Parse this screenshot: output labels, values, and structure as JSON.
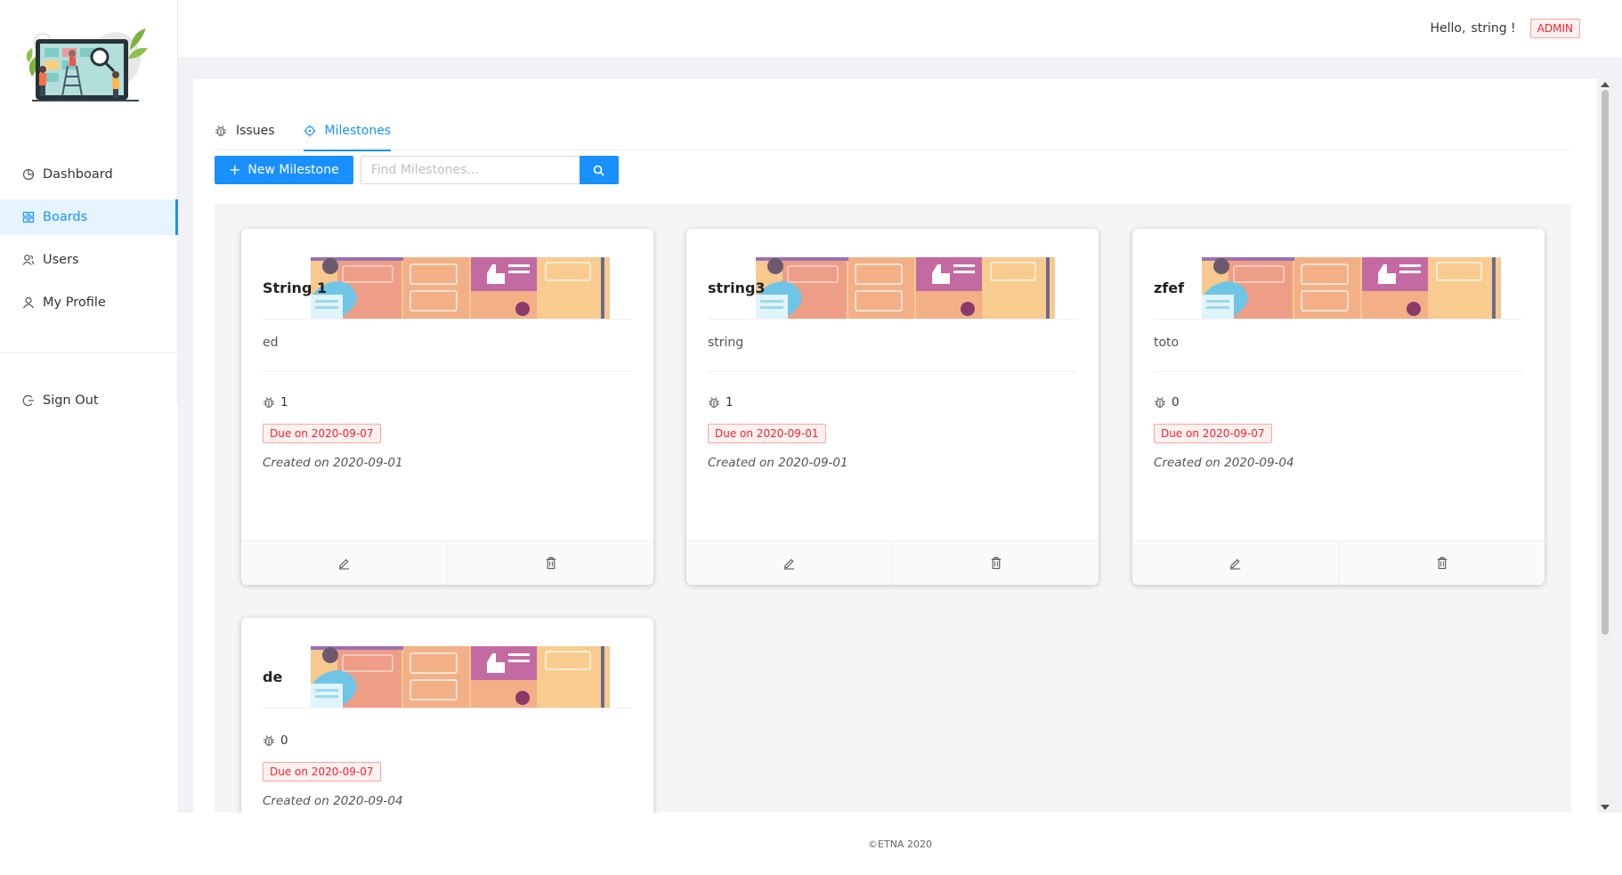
{
  "header": {
    "hello": "Hello,",
    "username": "string !",
    "role": "ADMIN"
  },
  "sidebar": {
    "items": [
      {
        "label": "Dashboard",
        "icon": "pie-chart-icon"
      },
      {
        "label": "Boards",
        "icon": "grid-icon",
        "active": true
      },
      {
        "label": "Users",
        "icon": "users-icon"
      },
      {
        "label": "My Profile",
        "icon": "user-icon"
      }
    ],
    "sign_out": "Sign Out"
  },
  "tabs": [
    {
      "label": "Issues",
      "icon": "bug-icon"
    },
    {
      "label": "Milestones",
      "icon": "aim-icon",
      "active": true
    }
  ],
  "toolbar": {
    "new_label": "New Milestone",
    "search_placeholder": "Find Milestones..."
  },
  "milestones": [
    {
      "title": "String 1",
      "description": "ed",
      "issues": "1",
      "due": "Due on 2020-09-07",
      "created": "Created on 2020-09-01"
    },
    {
      "title": "string3",
      "description": "string",
      "issues": "1",
      "due": "Due on 2020-09-01",
      "created": "Created on 2020-09-01"
    },
    {
      "title": "zfef",
      "description": "toto",
      "issues": "0",
      "due": "Due on 2020-09-07",
      "created": "Created on 2020-09-04"
    },
    {
      "title": "de",
      "description": "",
      "issues": "0",
      "due": "Due on 2020-09-07",
      "created": "Created on 2020-09-04"
    }
  ],
  "footer": {
    "text": "©ETNA 2020"
  },
  "colors": {
    "primary": "#1890ff",
    "danger": "#f5222d",
    "danger_bg": "#fff1f0"
  }
}
